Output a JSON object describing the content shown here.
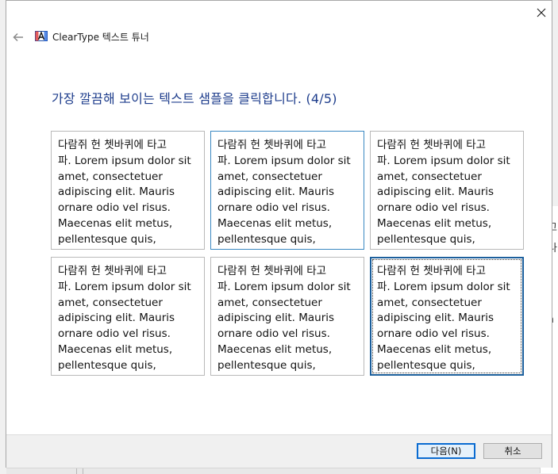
{
  "window": {
    "title": "ClearType 텍스트 튜너",
    "close_glyph": "✕",
    "back_glyph": "←",
    "icons": {
      "app": "cleartype-app-icon",
      "back": "back-arrow-icon",
      "close": "close-icon"
    }
  },
  "heading": "가장 깔끔해 보이는 텍스트 샘플을 클릭합니다. (4/5)",
  "samples": [
    {
      "text": "다람쥐 헌 쳇바퀴에 타고\n파. Lorem ipsum dolor sit\namet, consectetuer\nadipiscing elit. Mauris\nornare odio vel risus.\nMaecenas elit metus,\npellentesque quis,"
    },
    {
      "text": "다람쥐 헌 쳇바퀴에 타고\n파. Lorem ipsum dolor sit\namet, consectetuer\nadipiscing elit. Mauris\nornare odio vel risus.\nMaecenas elit metus,\npellentesque quis,"
    },
    {
      "text": "다람쥐 헌 쳇바퀴에 타고\n파. Lorem ipsum dolor sit\namet, consectetuer\nadipiscing elit. Mauris\nornare odio vel risus.\nMaecenas elit metus,\npellentesque quis,"
    },
    {
      "text": "다람쥐 헌 쳇바퀴에 타고\n파. Lorem ipsum dolor sit\namet, consectetuer\nadipiscing elit. Mauris\nornare odio vel risus.\nMaecenas elit metus,\npellentesque quis,"
    },
    {
      "text": "다람쥐 헌 쳇바퀴에 타고\n파. Lorem ipsum dolor sit\namet, consectetuer\nadipiscing elit. Mauris\nornare odio vel risus.\nMaecenas elit metus,\npellentesque quis,"
    },
    {
      "text": "다람쥐 헌 쳇바퀴에 타고\n파. Lorem ipsum dolor sit\namet, consectetuer\nadipiscing elit. Mauris\nornare odio vel risus.\nMaecenas elit metus,\npellentesque quis,"
    }
  ],
  "selected_sample": 6,
  "buttons": {
    "next": "다음(N)",
    "cancel": "취소"
  },
  "background_window": {
    "fragments": [
      "고",
      "나",
      "|",
      "a"
    ]
  },
  "colors": {
    "heading": "#1e3d8c",
    "selected_border": "#1c5f9c",
    "hover_border": "#3a88c2",
    "default_button_border": "#0a6bd1"
  }
}
